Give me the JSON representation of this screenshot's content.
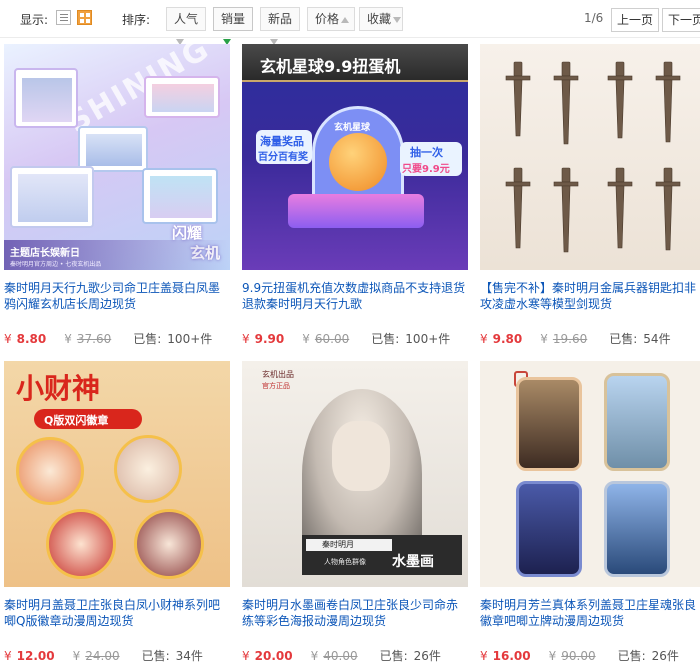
{
  "toolbar": {
    "display_label": "显示:",
    "sort_label": "排序:",
    "sort_options": [
      "人气",
      "销量",
      "新品",
      "价格",
      "收藏"
    ],
    "page_indicator": "1/6",
    "prev_label": "上一页",
    "next_label": "下一页"
  },
  "currency": "¥",
  "sold_label": "已售:",
  "products": [
    {
      "title": "秦时明月天行九歌少司命卫庄盖聂白凤墨鸦闪耀玄机店长周边现货",
      "price": "8.80",
      "original_price": "37.60",
      "sold": "100+件",
      "thumb": {
        "text1": "主题店长娱新日",
        "text2": "秦时明月官方周边 • 七夜玄机出品",
        "text3": "闪耀",
        "text4": "玄机",
        "bg_text": "SHINING"
      }
    },
    {
      "title": "9.9元扭蛋机充值次数虚拟商品不支持退货退款秦时明月天行九歌",
      "price": "9.90",
      "original_price": "60.00",
      "sold": "100+件",
      "thumb": {
        "banner": "玄机星球9.9扭蛋机",
        "logo": "玄机星球",
        "tag1": "海量奖品",
        "tag2": "百分百有奖",
        "tag3": "抽一次",
        "tag4": "只要9.9元"
      }
    },
    {
      "title": "【售完不补】秦时明月金属兵器钥匙扣非攻凌虚水寒等模型剑现货",
      "price": "9.80",
      "original_price": "19.60",
      "sold": "54件",
      "thumb": {}
    },
    {
      "title": "秦时明月盖聂卫庄张良白凤小财神系列吧唧Q版徽章动漫周边现货",
      "price": "12.00",
      "original_price": "24.00",
      "sold": "34件",
      "thumb": {
        "title": "小财神",
        "subtitle": "Q版双闪徽章"
      }
    },
    {
      "title": "秦时明月水墨画卷白凤卫庄张良少司命赤练等彩色海报动漫周边现货",
      "price": "20.00",
      "original_price": "40.00",
      "sold": "26件",
      "thumb": {
        "brand": "玄机出品",
        "stamp": "官方正品",
        "caption1": "秦时明月",
        "caption2": "人物角色群像",
        "caption3": "水墨画"
      }
    },
    {
      "title": "秦时明月芳兰真体系列盖聂卫庄星魂张良徽章吧唧立牌动漫周边现货",
      "price": "16.00",
      "original_price": "90.00",
      "sold": "26件",
      "thumb": {}
    }
  ]
}
